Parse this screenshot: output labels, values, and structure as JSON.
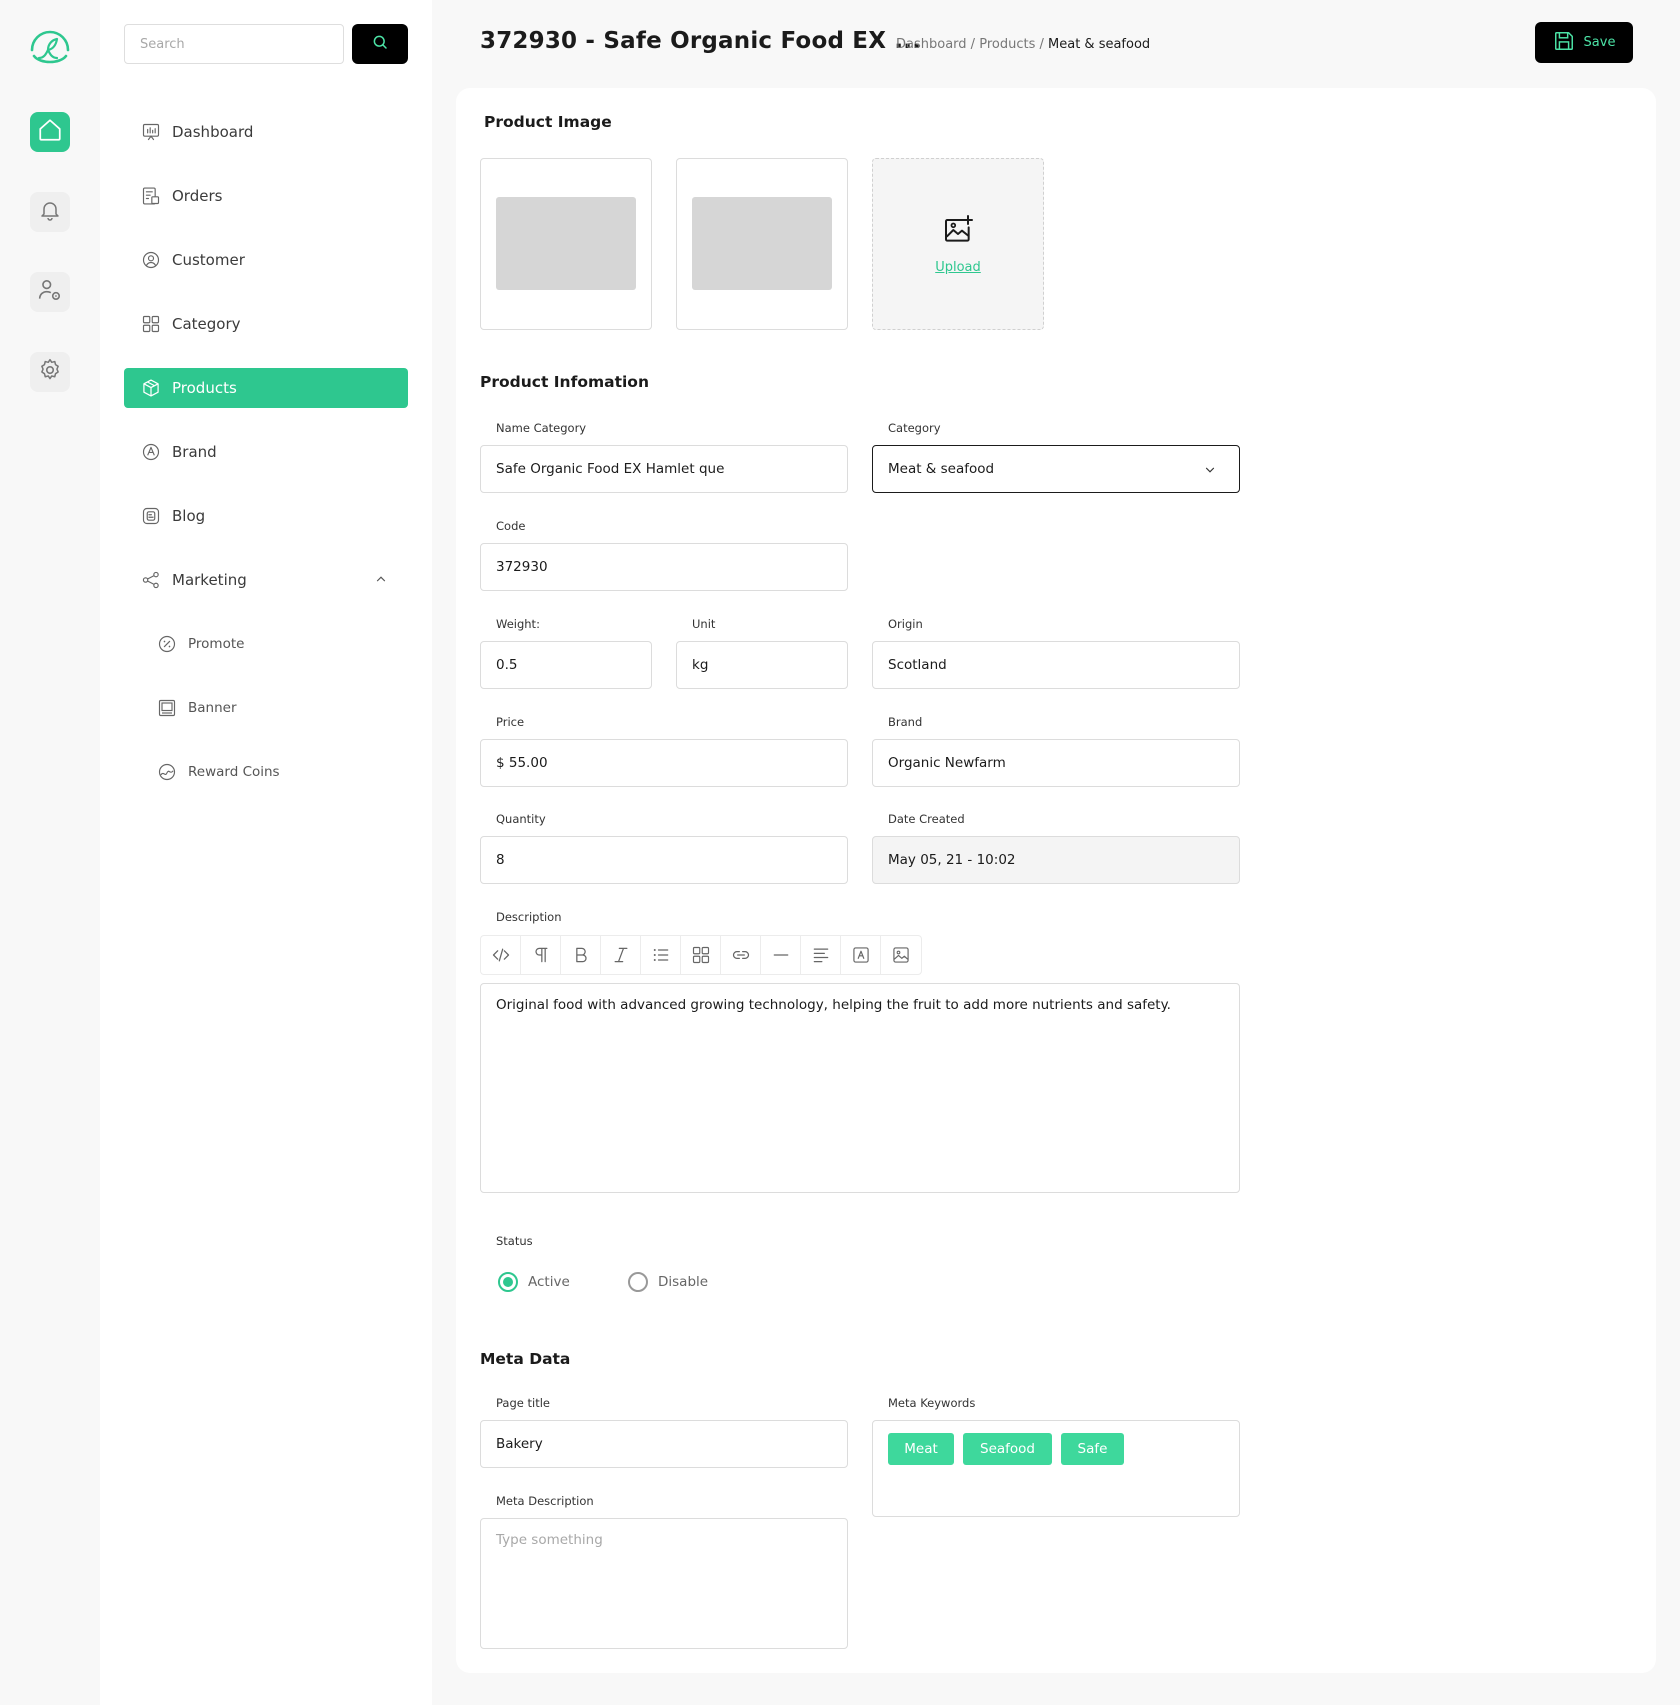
{
  "search": {
    "placeholder": "Search"
  },
  "sidebar": {
    "items": [
      {
        "label": "Dashboard",
        "icon": "dashboard-icon"
      },
      {
        "label": "Orders",
        "icon": "orders-icon"
      },
      {
        "label": "Customer",
        "icon": "customer-icon"
      },
      {
        "label": "Category",
        "icon": "category-icon"
      },
      {
        "label": "Products",
        "icon": "products-icon",
        "active": true
      },
      {
        "label": "Brand",
        "icon": "brand-icon"
      },
      {
        "label": "Blog",
        "icon": "blog-icon"
      },
      {
        "label": "Marketing",
        "icon": "marketing-icon",
        "expanded": true
      },
      {
        "label": "Promote",
        "icon": "promote-icon"
      },
      {
        "label": "Banner",
        "icon": "banner-icon"
      },
      {
        "label": "Reward Coins",
        "icon": "reward-coins-icon"
      }
    ]
  },
  "header": {
    "title": "372930 - Safe Organic Food EX ...",
    "breadcrumb": [
      "Dashboard",
      "Products",
      "Meat & seafood"
    ],
    "breadcrumb_sep": "/",
    "save_label": "Save"
  },
  "product_image": {
    "title": "Product Image",
    "upload_label": "Upload"
  },
  "info": {
    "title": "Product Infomation",
    "name_label": "Name Category",
    "name_value": "Safe Organic Food EX Hamlet que",
    "category_label": "Category",
    "category_value": "Meat & seafood",
    "code_label": "Code",
    "code_value": "372930",
    "weight_label": "Weight:",
    "weight_value": "0.5",
    "unit_label": "Unit",
    "unit_value": "kg",
    "origin_label": "Origin",
    "origin_value": "Scotland",
    "price_label": "Price",
    "price_value": "$ 55.00",
    "brand_label": "Brand",
    "brand_value": "Organic Newfarm",
    "quantity_label": "Quantity",
    "quantity_value": "8",
    "date_label": "Date Created",
    "date_value": "May 05, 21 - 10:02",
    "description_label": "Description",
    "description_value": "Original food with advanced growing technology, helping the fruit to add more nutrients and safety.",
    "toolbar": [
      "code-icon",
      "paragraph-icon",
      "bold-icon",
      "italic-icon",
      "list-icon",
      "grid-icon",
      "link-icon",
      "divider-icon",
      "align-icon",
      "text-color-icon",
      "image-icon"
    ]
  },
  "status": {
    "label": "Status",
    "options": [
      "Active",
      "Disable"
    ],
    "selected": "Active"
  },
  "meta": {
    "title": "Meta Data",
    "page_title_label": "Page title",
    "page_title_value": "Bakery",
    "description_label": "Meta Description",
    "description_placeholder": "Type something",
    "keywords_label": "Meta Keywords",
    "keywords": [
      "Meat",
      "Seafood",
      "Safe"
    ]
  },
  "colors": {
    "accent": "#2ec78f",
    "tag": "#3ed89c",
    "dark": "#000000"
  }
}
